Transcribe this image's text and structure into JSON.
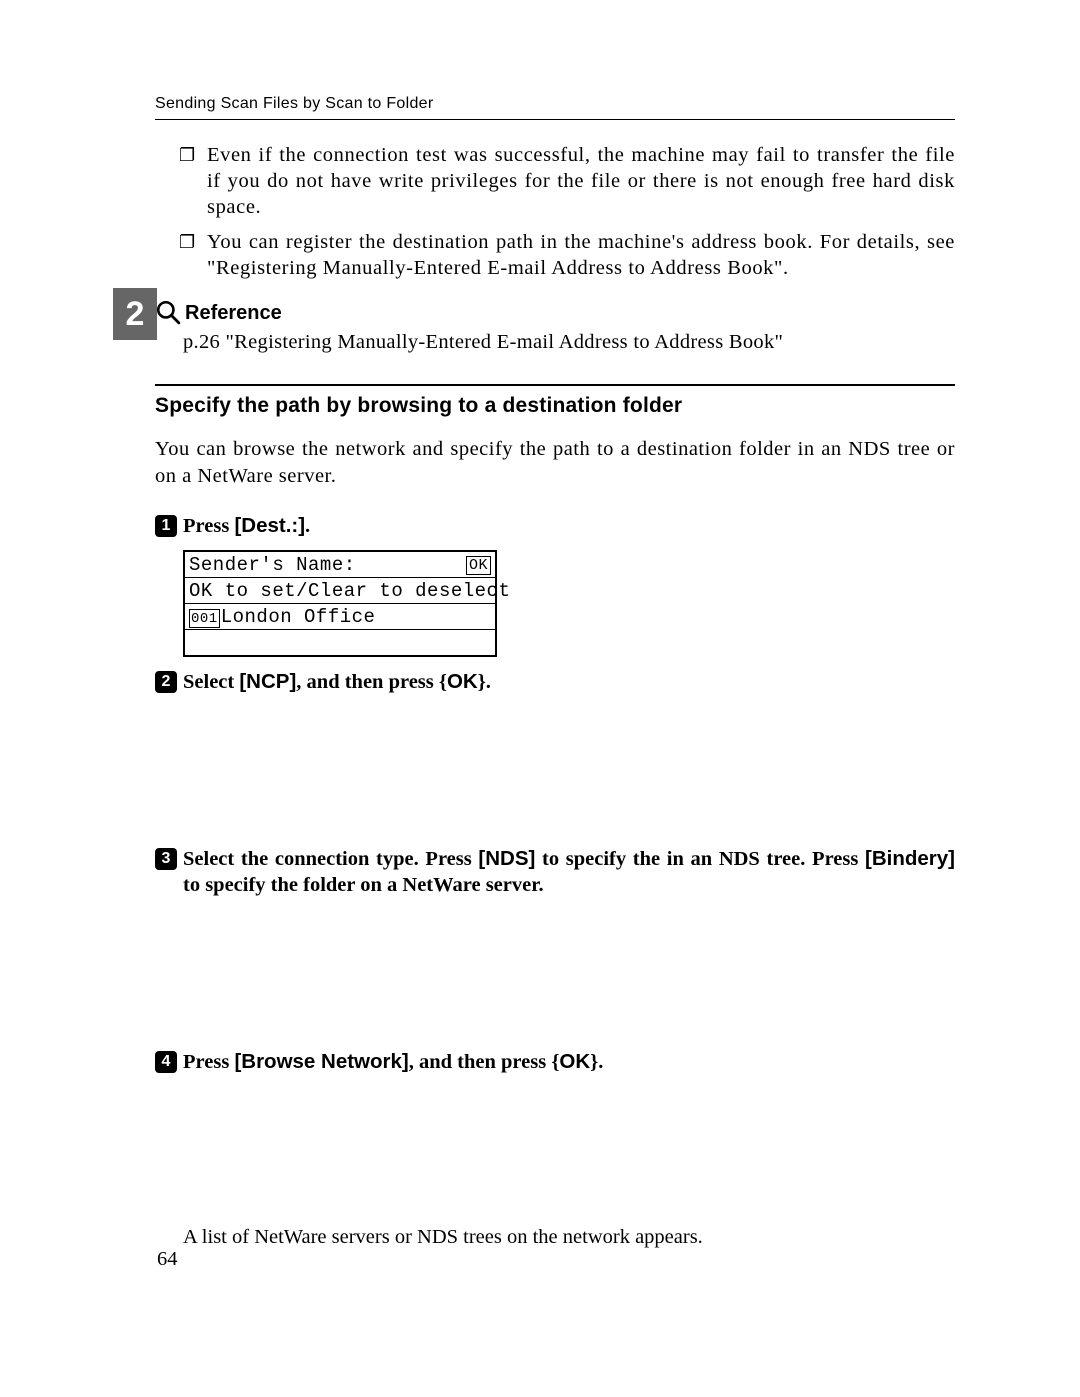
{
  "header": "Sending Scan Files by Scan to Folder",
  "chapter_tab": "2",
  "bullets": [
    "Even if the connection test was successful, the machine may fail to transfer the file if you do not have write privileges for the file or there is not enough free hard disk space.",
    "You can register the destination path in the machine's address book. For details, see \"Registering Manually-Entered E-mail Address to Address Book\"."
  ],
  "reference": {
    "label": "Reference",
    "text": "p.26 \"Registering Manually-Entered E-mail Address to Address Book\""
  },
  "subheading": "Specify the path by browsing to a destination folder",
  "sub_body": "You can browse the network and specify the path to a destination folder in an NDS tree or on a NetWare server.",
  "steps": {
    "s1": {
      "n": "1",
      "pre": "Press ",
      "btn": "[Dest.:]",
      "post": "."
    },
    "s2": {
      "n": "2",
      "pre": "Select ",
      "btn": "[NCP]",
      "mid": ", and then press ",
      "key": "OK",
      "post": "."
    },
    "s3": {
      "n": "3",
      "text_a": "Select the connection type. Press ",
      "btn_a": "[NDS]",
      "text_b": " to specify the in an NDS tree. Press ",
      "btn_b": "[Bindery]",
      "text_c": " to specify the folder on a NetWare server."
    },
    "s4": {
      "n": "4",
      "pre": "Press ",
      "btn": "[Browse Network]",
      "mid": ", and then press ",
      "key": "OK",
      "post": "."
    }
  },
  "lcd": {
    "row1": "Sender's Name:",
    "ok": "OK",
    "row2": "OK to set/Clear to deselect",
    "row3_tag": "001",
    "row3": "London Office"
  },
  "follow_text": "A list of NetWare servers or NDS trees on the network appears.",
  "page_num": "64"
}
